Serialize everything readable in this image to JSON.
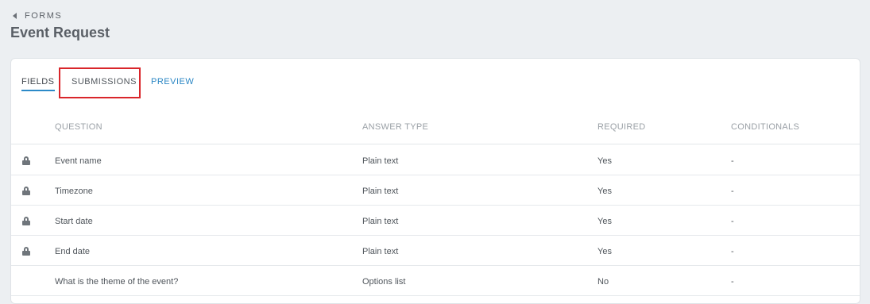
{
  "breadcrumb": {
    "label": "FORMS"
  },
  "page": {
    "title": "Event Request"
  },
  "tabs": [
    {
      "label": "FIELDS",
      "active": true
    },
    {
      "label": "SUBMISSIONS",
      "active": false
    },
    {
      "label": "PREVIEW",
      "active": false
    }
  ],
  "table": {
    "headers": {
      "question": "QUESTION",
      "answer_type": "ANSWER TYPE",
      "required": "REQUIRED",
      "conditionals": "CONDITIONALS"
    },
    "rows": [
      {
        "locked": true,
        "question": "Event name",
        "answer_type": "Plain text",
        "required": "Yes",
        "conditionals": "-"
      },
      {
        "locked": true,
        "question": "Timezone",
        "answer_type": "Plain text",
        "required": "Yes",
        "conditionals": "-"
      },
      {
        "locked": true,
        "question": "Start date",
        "answer_type": "Plain text",
        "required": "Yes",
        "conditionals": "-"
      },
      {
        "locked": true,
        "question": "End date",
        "answer_type": "Plain text",
        "required": "Yes",
        "conditionals": "-"
      },
      {
        "locked": false,
        "question": "What is the theme of the event?",
        "answer_type": "Options list",
        "required": "No",
        "conditionals": "-"
      }
    ]
  },
  "colors": {
    "accent": "#2a86c4",
    "highlight_box": "#d9262b",
    "background": "#eceff2"
  }
}
